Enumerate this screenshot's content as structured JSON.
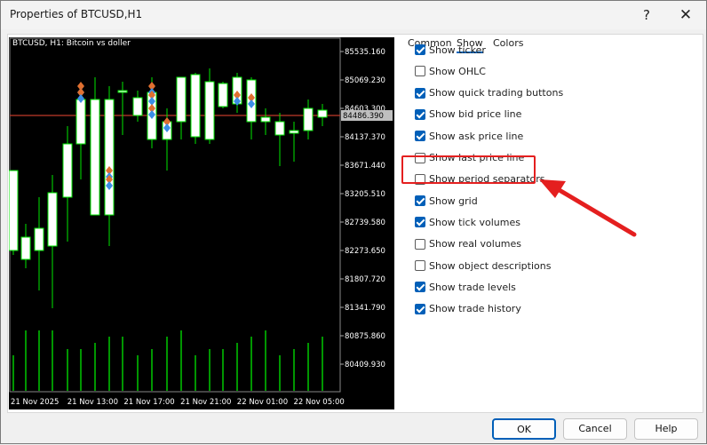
{
  "window": {
    "title": "Properties of BTCUSD,H1",
    "help_glyph": "?",
    "close_glyph": "✕"
  },
  "chart": {
    "label": "BTCUSD, H1:  Bitcoin vs doller",
    "price_labels": [
      "85535.160",
      "85069.230",
      "84603.300",
      "84137.370",
      "83671.440",
      "83205.510",
      "82739.580",
      "82273.650",
      "81807.720",
      "81341.790",
      "80875.860",
      "80409.930"
    ],
    "current_price": "84486.390",
    "time_labels": [
      "21 Nov 2025",
      "21 Nov 13:00",
      "21 Nov 17:00",
      "21 Nov 21:00",
      "22 Nov 01:00",
      "22 Nov 05:00"
    ],
    "colors": {
      "background": "#000000",
      "candle": "#00e600",
      "bull_body": "#000000",
      "bear_body": "#ffffff",
      "price_line": "#c0392b",
      "grid": "#3a3a3a"
    }
  },
  "tabs": [
    {
      "label": "Common"
    },
    {
      "label": "Show"
    },
    {
      "label": "Colors"
    }
  ],
  "active_tab": "Show",
  "options": [
    {
      "label": "Show ticker",
      "checked": true
    },
    {
      "label": "Show OHLC",
      "checked": false
    },
    {
      "label": "Show quick trading buttons",
      "checked": true
    },
    {
      "label": "Show bid price line",
      "checked": true
    },
    {
      "label": "Show ask price line",
      "checked": true
    },
    {
      "label": "Show last price line",
      "checked": false
    },
    {
      "label": "Show period separators",
      "checked": false
    },
    {
      "label": "Show grid",
      "checked": true
    },
    {
      "label": "Show tick volumes",
      "checked": true
    },
    {
      "label": "Show real volumes",
      "checked": false
    },
    {
      "label": "Show object descriptions",
      "checked": false
    },
    {
      "label": "Show trade levels",
      "checked": true
    },
    {
      "label": "Show trade history",
      "checked": true
    }
  ],
  "buttons": {
    "ok": "OK",
    "cancel": "Cancel",
    "help": "Help"
  },
  "annotation_color": "#e41f1f"
}
